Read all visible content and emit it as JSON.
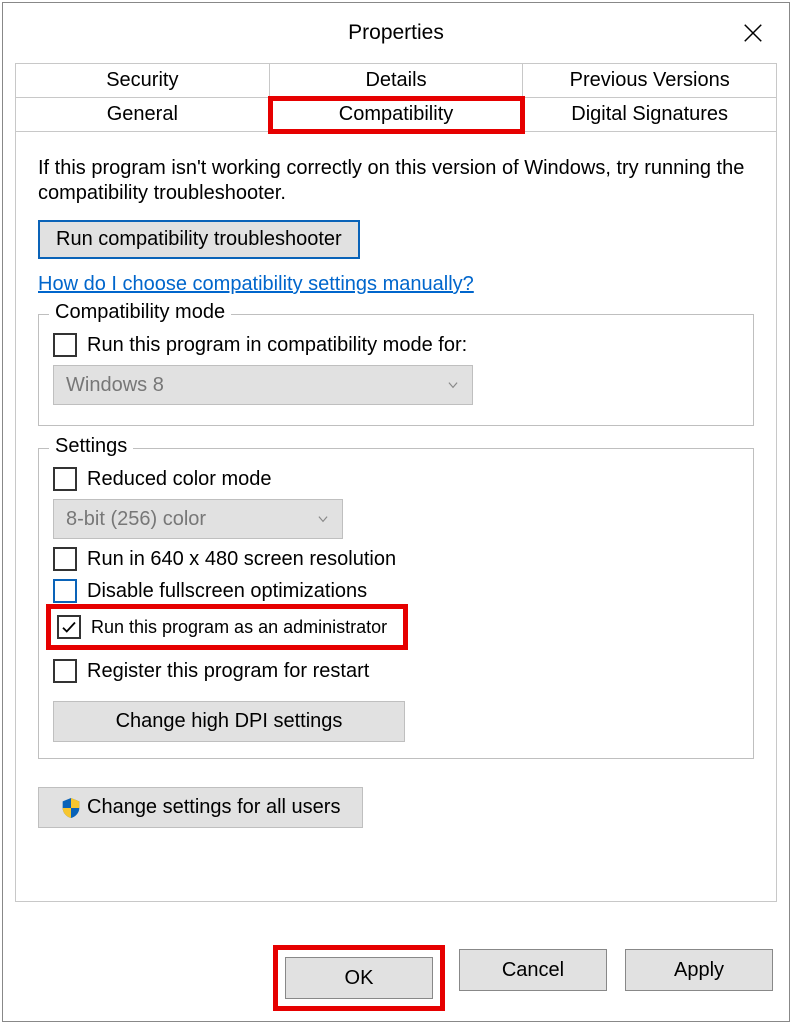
{
  "title": "Properties",
  "tabs": {
    "row1": [
      "Security",
      "Details",
      "Previous Versions"
    ],
    "row2": [
      "General",
      "Compatibility",
      "Digital Signatures"
    ],
    "active": "Compatibility"
  },
  "intro": "If this program isn't working correctly on this version of Windows, try running the compatibility troubleshooter.",
  "run_troubleshooter": "Run compatibility troubleshooter",
  "help_link": "How do I choose compatibility settings manually?",
  "compat_group": {
    "legend": "Compatibility mode",
    "checkbox": "Run this program in compatibility mode for:",
    "dropdown": "Windows 8"
  },
  "settings_group": {
    "legend": "Settings",
    "reduced_color": "Reduced color mode",
    "color_dropdown": "8-bit (256) color",
    "run_640": "Run in 640 x 480 screen resolution",
    "disable_fullscreen": "Disable fullscreen optimizations",
    "run_admin": "Run this program as an administrator",
    "register_restart": "Register this program for restart",
    "dpi_button": "Change high DPI settings"
  },
  "all_users_button": "Change settings for all users",
  "buttons": {
    "ok": "OK",
    "cancel": "Cancel",
    "apply": "Apply"
  },
  "checks": {
    "compat_mode": false,
    "reduced_color": false,
    "run_640": false,
    "disable_fullscreen": false,
    "run_admin": true,
    "register_restart": false
  }
}
